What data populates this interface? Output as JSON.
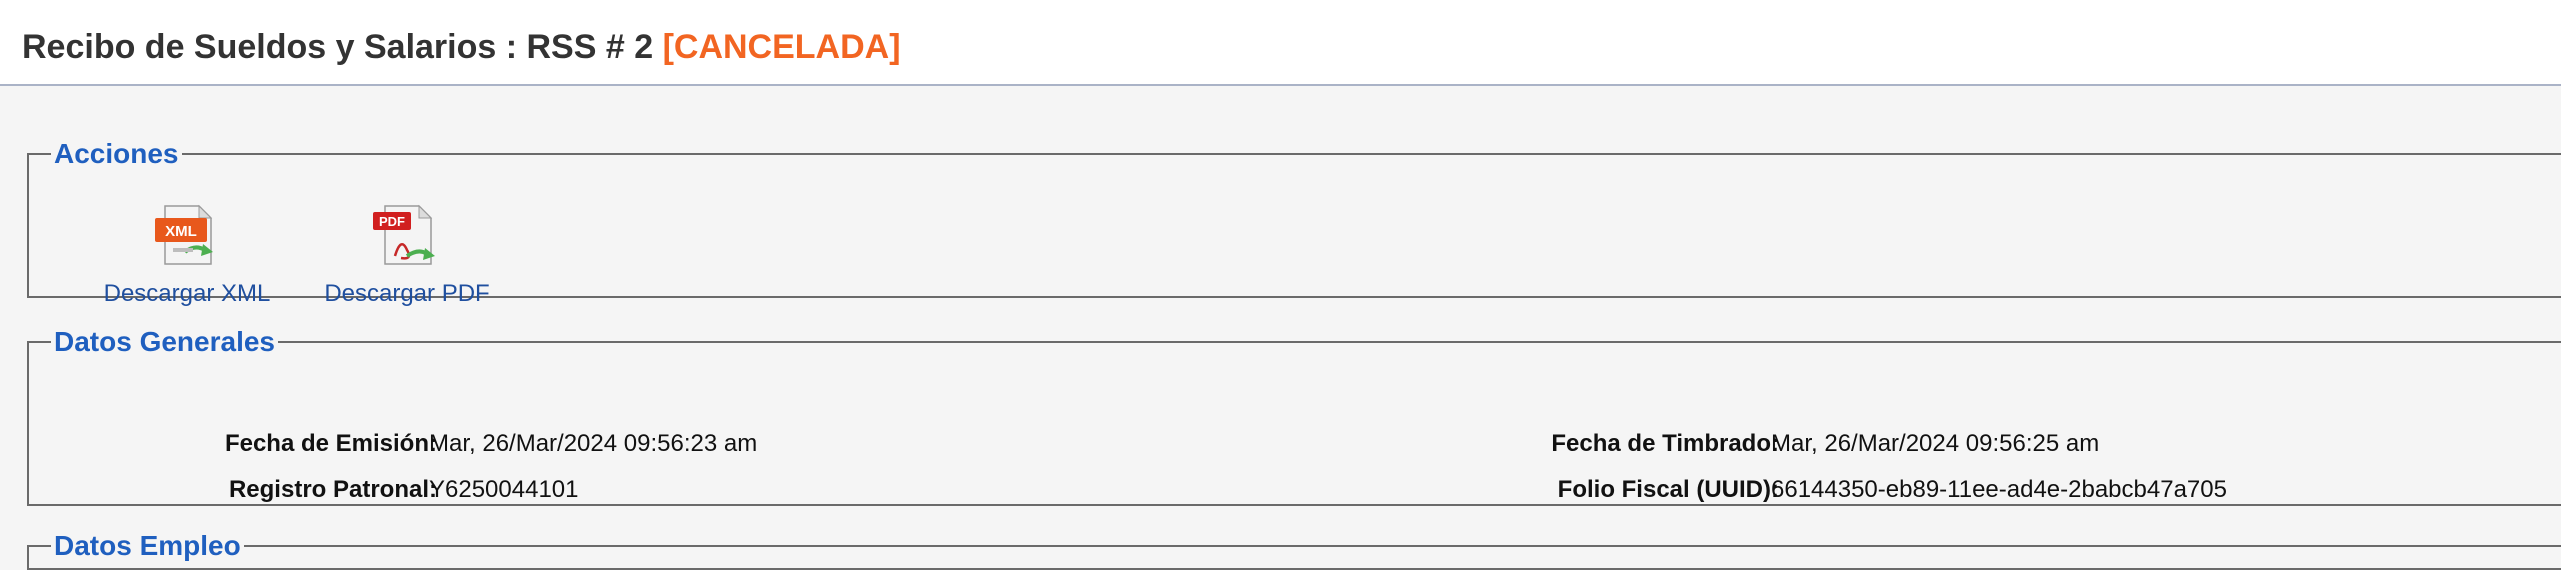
{
  "header": {
    "title": "Recibo de Sueldos y Salarios : RSS # 2",
    "status": "[CANCELADA]"
  },
  "acciones": {
    "legend": "Acciones",
    "items": [
      {
        "label": "Descargar XML",
        "icon": "xml-file-icon",
        "badge": "XML"
      },
      {
        "label": "Descargar PDF",
        "icon": "pdf-file-icon",
        "badge": "PDF"
      }
    ]
  },
  "datos_generales": {
    "legend": "Datos Generales",
    "left": [
      {
        "label": "Fecha de Emisión:",
        "value": "Mar, 26/Mar/2024 09:56:23 am"
      },
      {
        "label": "Registro Patronal:",
        "value": "Y6250044101"
      }
    ],
    "right": [
      {
        "label": "Fecha de Timbrado:",
        "value": "Mar, 26/Mar/2024 09:56:25 am"
      },
      {
        "label": "Folio Fiscal (UUID):",
        "value": "66144350-eb89-11ee-ad4e-2babcb47a705"
      }
    ]
  },
  "datos_empleo": {
    "legend": "Datos Empleo"
  },
  "colors": {
    "accent": "#1f5fbf",
    "status": "#f26522"
  }
}
